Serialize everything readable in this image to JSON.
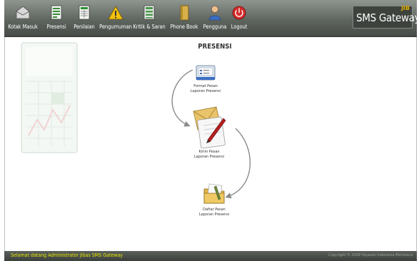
{
  "nav": [
    {
      "label": "Kotak Masuk",
      "icon": "inbox-icon"
    },
    {
      "label": "Presensi",
      "icon": "attendance-icon"
    },
    {
      "label": "Penilaian",
      "icon": "grades-icon"
    },
    {
      "label": "Pengumuman",
      "icon": "announcement-warning-icon"
    },
    {
      "label": "Kritik & Saran",
      "icon": "feedback-list-icon"
    },
    {
      "label": "Phone Book",
      "icon": "phone-book-icon"
    },
    {
      "label": "Pengguna",
      "icon": "user-icon"
    },
    {
      "label": "Logout",
      "icon": "power-icon"
    }
  ],
  "brand": {
    "jib": "JIB",
    "title": "SMS Gateway"
  },
  "page": {
    "title": "PRESENSI"
  },
  "items": [
    {
      "line1": "Format Pesan",
      "line2": "Laporan Presensi",
      "icon": "message-format-icon"
    },
    {
      "line1": "Kirim Pesan",
      "line2": "Laporan Presensi",
      "icon": "send-message-icon"
    },
    {
      "line1": "Daftar Pesan",
      "line2": "Laporan Presensi",
      "icon": "message-folder-icon"
    }
  ],
  "footer": {
    "welcome": "Selamat datang Administrator Jibas SMS Gateway",
    "copyright": "Copyright © 2009 Yayasan Indonesia Membaca"
  },
  "colors": {
    "topbar": "#5f655f",
    "footer_text": "#e6e600",
    "arrow": "#8a8a8a"
  }
}
